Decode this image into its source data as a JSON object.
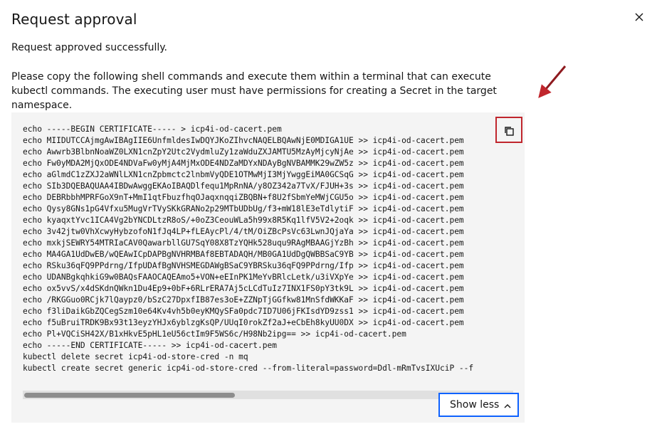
{
  "dialog": {
    "title": "Request approval",
    "success_message": "Request approved successfully.",
    "instructions": "Please copy the following shell commands and execute them within a terminal that can execute kubectl commands. The executing user must have permissions for creating a Secret in the target namespace."
  },
  "code": {
    "lines": [
      "echo -----BEGIN CERTIFICATE----- > icp4i-od-cacert.pem",
      "echo MIIDUTCCAjmgAwIBAgIIE6UnfmldesIwDQYJKoZIhvcNAQELBQAwNjE0MDIGA1UE >> icp4i-od-cacert.pem",
      "echo Awwrb3BlbnNoaWZ0LXN1cnZpY2Utc2VydmluZy1zaWduZXJAMTU5MzAyMjcyNjAe >> icp4i-od-cacert.pem",
      "echo Fw0yMDA2MjQxODE4NDVaFw0yMjA4MjMxODE4NDZaMDYxNDAyBgNVBAMMK29wZW5z >> icp4i-od-cacert.pem",
      "echo aGlmdC1zZXJ2aWNlLXN1cnZpbmctc2lnbmVyQDE1OTMwMjI3MjYwggEiMA0GCSqG >> icp4i-od-cacert.pem",
      "echo SIb3DQEBAQUAA4IBDwAwggEKAoIBAQDlfequ1MpRnNA/y8OZ342a7TvX/FJUH+3s >> icp4i-od-cacert.pem",
      "echo DEBRbbhMPRFGoX9nT+MmI1qtFbuzfhqOJaqxnqqiZBQBN+f8U2fSbmYeMWjCGU5o >> icp4i-od-cacert.pem",
      "echo Qysy8GNs1pG4Vfxu5MugVrTVySKkGRANo2p29MTbUDbUg/f3+mW18lE3eTdlytiF >> icp4i-od-cacert.pem",
      "echo kyaqxtYvc1ICA4Vg2bYNCDLtzR8oS/+0oZ3CeouWLa5h99x8R5Kq1lfV5V2+2oqk >> icp4i-od-cacert.pem",
      "echo 3v42jtw0VhXcwyHybzofoN1fJq4LP+fLEAycPl/4/tM/OiZBcPsVc63LwnJQjaYa >> icp4i-od-cacert.pem",
      "echo mxkjSEWRY54MTRIaCAV0QawarbllGU7SqY08X8TzYQHk528uqu9RAgMBAAGjYzBh >> icp4i-od-cacert.pem",
      "echo MA4GA1UdDwEB/wQEAwICpDAPBgNVHRMBAf8EBTADAQH/MB0GA1UdDgQWBBSaC9YB >> icp4i-od-cacert.pem",
      "echo RSku36qFQ9PPdrng/IfpUDAfBgNVHSMEGDAWgBSaC9YBRSku36qFQ9PPdrng/Ifp >> icp4i-od-cacert.pem",
      "echo UDANBgkqhkiG9w0BAQsFAAOCAQEAmo5+VON+eEInPK1MeYvBRlcLetk/u3iVXpYe >> icp4i-od-cacert.pem",
      "echo ox5vvS/x4dSKdnQWkn1Du4Ep9+0bF+6RLrERA7Aj5cLCdTuIz7INX1FS0pY3tk9L >> icp4i-od-cacert.pem",
      "echo /RKGGuo0RCjk7lQaypz0/bSzC27DpxfIB87es3oE+ZZNpTjGGfkw81MnSfdWKKaF >> icp4i-od-cacert.pem",
      "echo f3liDaikGbZQCegSzm10e64Kv4vh5b0eyKMQySFa0pdc7ID7U06jFKIsdYD9zss1 >> icp4i-od-cacert.pem",
      "echo f5uBruiTRDK9Bx93t13eyzYHJx6yblzgKsQP/UUqI0rokZf2aJ+eCbEh8kyUU0DX >> icp4i-od-cacert.pem",
      "echo Pl+VQCiSH42X/B1xHkvE5pHL1eU56ctIm9F5WS6c/H98Nb2ipg== >> icp4i-od-cacert.pem",
      "echo -----END CERTIFICATE----- >> icp4i-od-cacert.pem",
      "kubectl delete secret icp4i-od-store-cred -n mq",
      "kubectl create secret generic icp4i-od-store-cred --from-literal=password=Ddl-mRmTvsIXUciP --f"
    ],
    "copy_icon": "copy-icon",
    "show_less_label": "Show less",
    "show_less_icon": "chevron-up-icon",
    "horizontal_scroll_fraction": 0.43
  },
  "annotation": {
    "arrow_color": "#c0262d",
    "highlight_color": "#c0262d"
  },
  "colors": {
    "focus_blue": "#0f62fe",
    "code_background": "#f4f4f4"
  }
}
